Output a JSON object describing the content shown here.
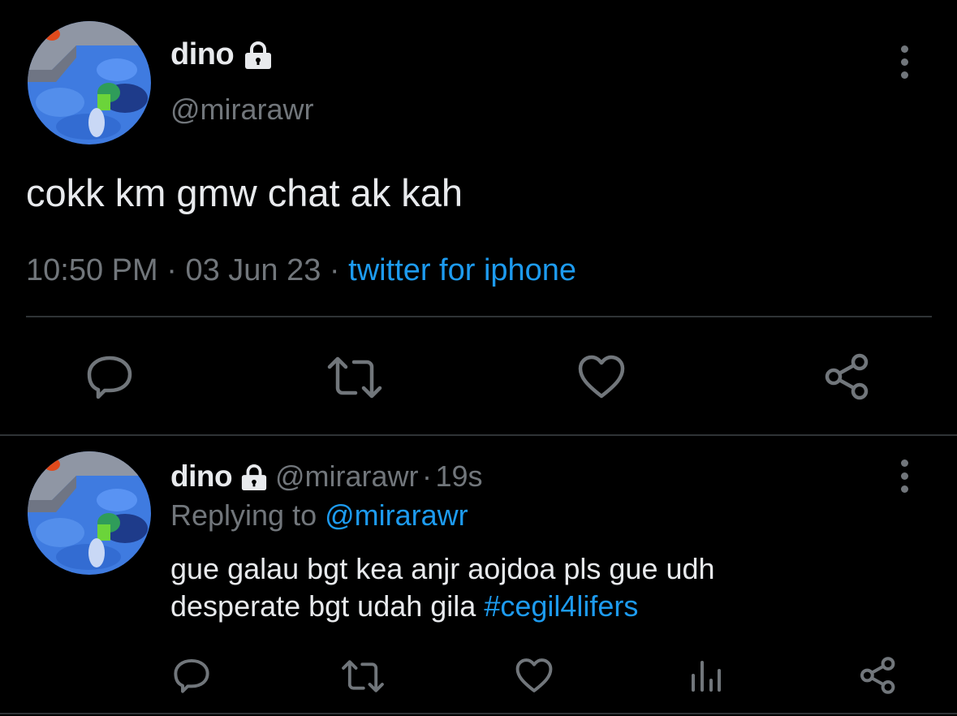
{
  "main_tweet": {
    "author_name": "dino",
    "author_handle": "@mirarawr",
    "text": "cokk km gmw chat ak kah",
    "time": "10:50 PM",
    "sep1": "·",
    "date": "03 Jun 23",
    "sep2": "·",
    "source": "twitter for iphone"
  },
  "reply_tweet": {
    "author_name": "dino",
    "author_handle": "@mirarawr",
    "sep": "·",
    "age": "19s",
    "replying_prefix": "Replying to",
    "replying_handle": "@mirarawr",
    "text_line1": "gue galau bgt kea anjr aojdoa pls gue udh",
    "text_line2": "desperate bgt udah gila",
    "hashtag": "#cegil4lifers"
  },
  "icons": {
    "lock": "lock-icon",
    "more": "more-vertical-icon",
    "reply": "reply-icon",
    "retweet": "retweet-icon",
    "like": "heart-icon",
    "share": "share-icon",
    "views": "views-icon"
  },
  "colors": {
    "background": "#000000",
    "text": "#e8eaed",
    "muted": "#71767b",
    "link": "#1d9bf0",
    "divider": "#2f3336"
  }
}
